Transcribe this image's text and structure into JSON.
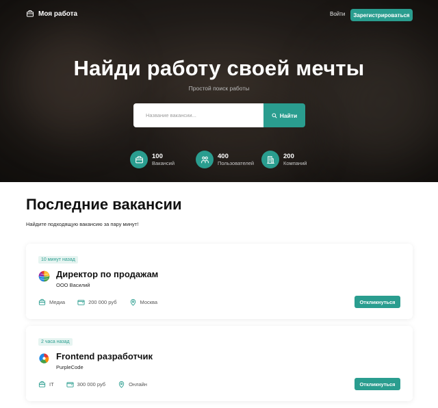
{
  "header": {
    "brand": "Моя работа",
    "login_label": "Войти",
    "register_label": "Зарегистрироваться"
  },
  "hero": {
    "title": "Найди работу своей мечты",
    "subtitle": "Простой поиск работы",
    "search_placeholder": "Название вакансии...",
    "search_button": "Найти"
  },
  "stats": [
    {
      "value": "100",
      "label": "Вакансий",
      "icon": "briefcase-icon"
    },
    {
      "value": "400",
      "label": "Пользователей",
      "icon": "users-icon"
    },
    {
      "value": "200",
      "label": "Компаний",
      "icon": "building-icon"
    }
  ],
  "section": {
    "title": "Последние вакансии",
    "subtitle": "Найдите подходящую вакансию за пару минут!"
  },
  "jobs": [
    {
      "posted": "10 минут назад",
      "title": "Директор по продажам",
      "company": "ООО Василий",
      "category": "Медиа",
      "salary": "200 000 руб",
      "location": "Москва",
      "apply_label": "Откликнуться"
    },
    {
      "posted": "2 часа назад",
      "title": "Frontend разработчик",
      "company": "PurpleCode",
      "category": "IT",
      "salary": "300 000 руб",
      "location": "Онлайн",
      "apply_label": "Откликнуться"
    }
  ],
  "colors": {
    "accent": "#2a9d8f",
    "badge_bg": "#e6f4f1"
  }
}
